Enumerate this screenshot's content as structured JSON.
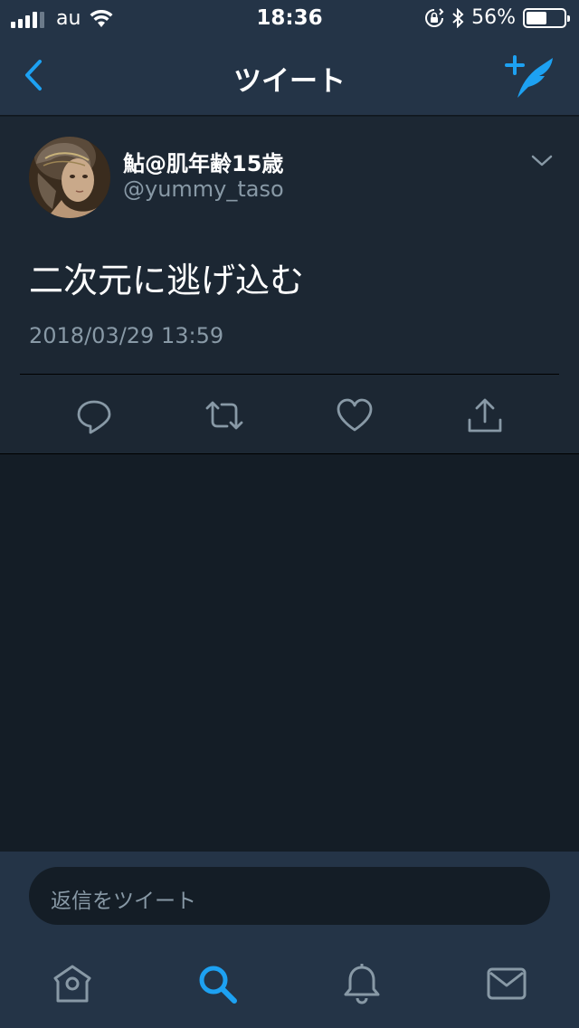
{
  "status_bar": {
    "carrier": "au",
    "time": "18:36",
    "battery_percent": "56%",
    "battery_level": 0.56,
    "icons": [
      "signal-icon",
      "wifi-icon",
      "orientation-lock-icon",
      "bluetooth-icon",
      "battery-icon"
    ]
  },
  "nav": {
    "title": "ツイート",
    "back_icon": "chevron-left-icon",
    "compose_icon": "compose-tweet-icon"
  },
  "tweet": {
    "display_name": "鮎@肌年齢15歳",
    "handle": "@yummy_taso",
    "text": "二次元に逃げ込む",
    "timestamp": "2018/03/29 13:59",
    "actions": [
      "reply-icon",
      "retweet-icon",
      "like-icon",
      "share-icon"
    ]
  },
  "reply": {
    "placeholder": "返信をツイート"
  },
  "tabs": [
    "home-icon",
    "search-icon",
    "notifications-icon",
    "messages-icon"
  ],
  "colors": {
    "accent": "#1da1f2",
    "background": "#141d26",
    "card": "#1c2733",
    "bar": "#243447",
    "secondary_text": "#8899a6"
  }
}
